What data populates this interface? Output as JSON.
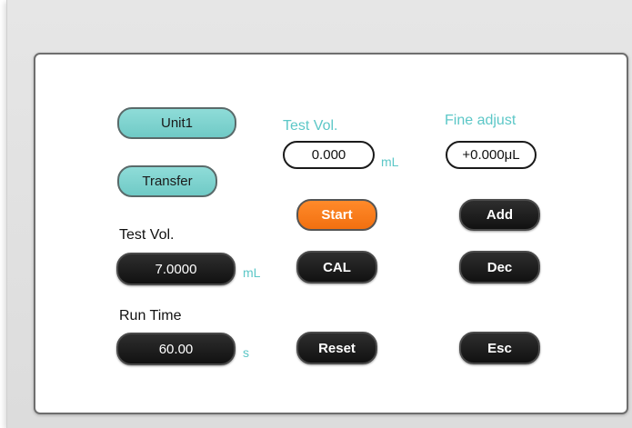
{
  "buttons": {
    "unit1": "Unit1",
    "transfer": "Transfer",
    "start": "Start",
    "cal": "CAL",
    "reset": "Reset",
    "add": "Add",
    "dec": "Dec",
    "esc": "Esc"
  },
  "fields": {
    "top_test_vol": {
      "label": "Test Vol.",
      "value": "0.000",
      "unit": "mL"
    },
    "fine_adjust": {
      "label": "Fine adjust",
      "value": "+0.000μL"
    },
    "test_vol": {
      "label": "Test Vol.",
      "value": "7.0000",
      "unit": "mL"
    },
    "run_time": {
      "label": "Run Time",
      "value": "60.00",
      "unit": "s"
    }
  },
  "colors": {
    "accent_teal": "#6fcac6",
    "start_orange": "#f27010",
    "button_dark": "#111111"
  }
}
